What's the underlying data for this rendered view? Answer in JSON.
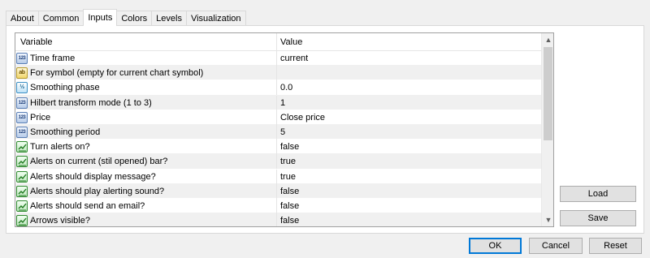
{
  "tabs": [
    {
      "label": "About",
      "active": false
    },
    {
      "label": "Common",
      "active": false
    },
    {
      "label": "Inputs",
      "active": true
    },
    {
      "label": "Colors",
      "active": false
    },
    {
      "label": "Levels",
      "active": false
    },
    {
      "label": "Visualization",
      "active": false
    }
  ],
  "grid": {
    "header": {
      "variable": "Variable",
      "value": "Value"
    },
    "rows": [
      {
        "type_icon": "int-icon",
        "icon_text": "123",
        "variable": "Time frame",
        "value": "current"
      },
      {
        "type_icon": "string-icon",
        "icon_text": "ab",
        "variable": "For symbol (empty for current chart symbol)",
        "value": ""
      },
      {
        "type_icon": "double-icon",
        "icon_text": "½",
        "variable": "Smoothing phase",
        "value": "0.0"
      },
      {
        "type_icon": "int-icon",
        "icon_text": "123",
        "variable": "Hilbert transform mode (1 to 3)",
        "value": "1"
      },
      {
        "type_icon": "int-icon",
        "icon_text": "123",
        "variable": "Price",
        "value": "Close price"
      },
      {
        "type_icon": "int-icon",
        "icon_text": "123",
        "variable": "Smoothing period",
        "value": "5"
      },
      {
        "type_icon": "bool-icon",
        "icon_text": "",
        "variable": "Turn alerts on?",
        "value": "false"
      },
      {
        "type_icon": "bool-icon",
        "icon_text": "",
        "variable": "Alerts on current (stil opened) bar?",
        "value": "true"
      },
      {
        "type_icon": "bool-icon",
        "icon_text": "",
        "variable": "Alerts should display message?",
        "value": "true"
      },
      {
        "type_icon": "bool-icon",
        "icon_text": "",
        "variable": "Alerts should play alerting sound?",
        "value": "false"
      },
      {
        "type_icon": "bool-icon",
        "icon_text": "",
        "variable": "Alerts should send an email?",
        "value": "false"
      },
      {
        "type_icon": "bool-icon",
        "icon_text": "",
        "variable": "Arrows visible?",
        "value": "false"
      }
    ]
  },
  "side_buttons": {
    "load": "Load",
    "save": "Save"
  },
  "footer_buttons": {
    "ok": "OK",
    "cancel": "Cancel",
    "reset": "Reset"
  },
  "icons": {
    "scroll_up": "scroll-up-arrow-icon",
    "scroll_down": "scroll-down-arrow-icon"
  }
}
